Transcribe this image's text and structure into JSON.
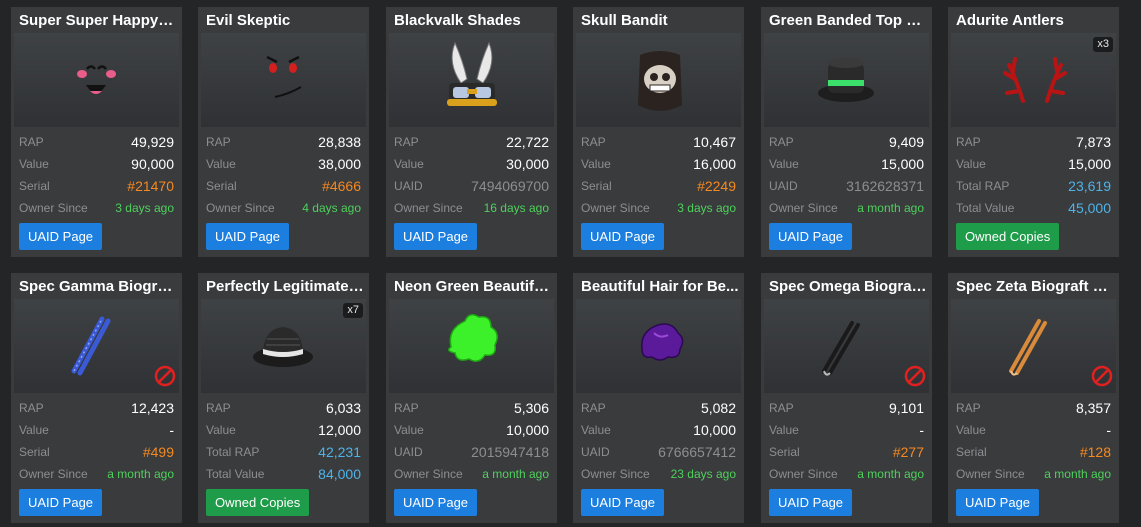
{
  "labels": {
    "rap": "RAP",
    "value": "Value",
    "serial": "Serial",
    "uaid": "UAID",
    "owner_since": "Owner Since",
    "total_rap": "Total RAP",
    "total_value": "Total Value",
    "uaid_page": "UAID Page",
    "owned_copies": "Owned Copies"
  },
  "colors": {
    "background": "#232527",
    "card": "#393b3d",
    "serial_orange": "#f6891f",
    "date_green": "#4fd05c",
    "total_blue": "#4fb3e8",
    "button_blue": "#1c7fe0",
    "button_green": "#1f9c4a"
  },
  "items": [
    {
      "name": "Super Super Happy F...",
      "image_icon": "happy-face-icon",
      "rap": "49,929",
      "value": "90,000",
      "third_label": "Serial",
      "third_value": "#21470",
      "fourth_label": "Owner Since",
      "fourth_value": "3 days ago",
      "button": "UAID Page"
    },
    {
      "name": "Evil Skeptic",
      "image_icon": "evil-face-icon",
      "rap": "28,838",
      "value": "38,000",
      "third_label": "Serial",
      "third_value": "#4666",
      "fourth_label": "Owner Since",
      "fourth_value": "4 days ago",
      "button": "UAID Page"
    },
    {
      "name": "Blackvalk Shades",
      "image_icon": "winged-shades-icon",
      "rap": "22,722",
      "value": "30,000",
      "third_label": "UAID",
      "third_value": "7494069700",
      "fourth_label": "Owner Since",
      "fourth_value": "16 days ago",
      "button": "UAID Page"
    },
    {
      "name": "Skull Bandit",
      "image_icon": "skull-mask-icon",
      "rap": "10,467",
      "value": "16,000",
      "third_label": "Serial",
      "third_value": "#2249",
      "fourth_label": "Owner Since",
      "fourth_value": "3 days ago",
      "button": "UAID Page"
    },
    {
      "name": "Green Banded Top Hat",
      "image_icon": "top-hat-icon",
      "rap": "9,409",
      "value": "15,000",
      "third_label": "UAID",
      "third_value": "3162628371",
      "fourth_label": "Owner Since",
      "fourth_value": "a month ago",
      "button": "UAID Page"
    },
    {
      "name": "Adurite Antlers",
      "image_icon": "antlers-icon",
      "quantity": "x3",
      "rap": "7,873",
      "value": "15,000",
      "third_label": "Total RAP",
      "third_value": "23,619",
      "fourth_label": "Total Value",
      "fourth_value": "45,000",
      "button": "Owned Copies"
    },
    {
      "name": "Spec Gamma Biograf...",
      "image_icon": "blue-biograft-icon",
      "rap": "12,423",
      "value": "-",
      "third_label": "Serial",
      "third_value": "#499",
      "fourth_label": "Owner Since",
      "fourth_value": "a month ago",
      "button": "UAID Page",
      "on_hold": true
    },
    {
      "name": "Perfectly Legitimate ...",
      "image_icon": "fedora-icon",
      "quantity": "x7",
      "rap": "6,033",
      "value": "12,000",
      "third_label": "Total RAP",
      "third_value": "42,231",
      "fourth_label": "Total Value",
      "fourth_value": "84,000",
      "button": "Owned Copies"
    },
    {
      "name": "Neon Green Beautifu...",
      "image_icon": "green-hair-icon",
      "rap": "5,306",
      "value": "10,000",
      "third_label": "UAID",
      "third_value": "2015947418",
      "fourth_label": "Owner Since",
      "fourth_value": "a month ago",
      "button": "UAID Page"
    },
    {
      "name": "Beautiful Hair for Be...",
      "image_icon": "purple-hair-icon",
      "rap": "5,082",
      "value": "10,000",
      "third_label": "UAID",
      "third_value": "6766657412",
      "fourth_label": "Owner Since",
      "fourth_value": "23 days ago",
      "button": "UAID Page"
    },
    {
      "name": "Spec Omega Biograf...",
      "image_icon": "black-biograft-icon",
      "rap": "9,101",
      "value": "-",
      "third_label": "Serial",
      "third_value": "#277",
      "fourth_label": "Owner Since",
      "fourth_value": "a month ago",
      "button": "UAID Page",
      "on_hold": true
    },
    {
      "name": "Spec Zeta Biograft E...",
      "image_icon": "orange-biograft-icon",
      "rap": "8,357",
      "value": "-",
      "third_label": "Serial",
      "third_value": "#128",
      "fourth_label": "Owner Since",
      "fourth_value": "a month ago",
      "button": "UAID Page",
      "on_hold": true
    }
  ]
}
